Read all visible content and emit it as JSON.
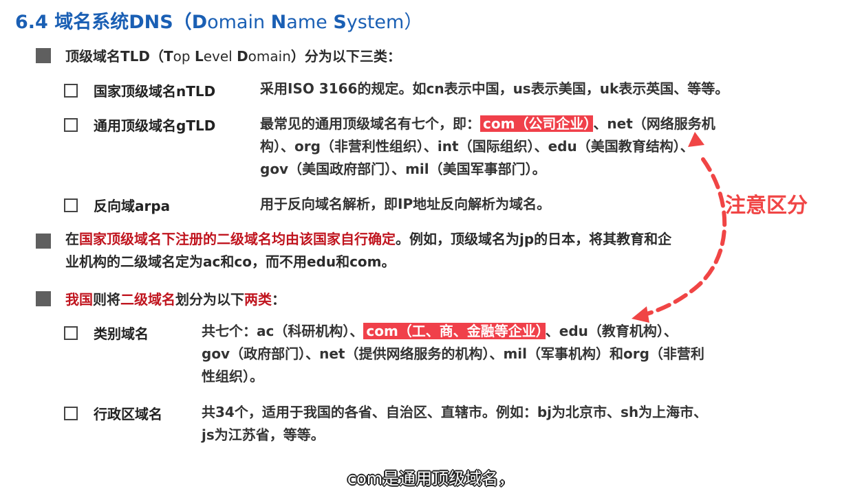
{
  "title": {
    "prefix": "6.4 域名系统DNS（",
    "d": "D",
    "omain": "omain ",
    "n": "N",
    "ame": "ame ",
    "s": "S",
    "ystem": "ystem）"
  },
  "tld_heading": {
    "prefix": "顶级域名TLD（",
    "t": "T",
    "op": "op ",
    "l": "L",
    "evel": "evel ",
    "d": "D",
    "omain": "omain",
    "suffix": "）分为以下三类："
  },
  "ntld": {
    "term": "国家顶级域名nTLD",
    "desc": "采用ISO 3166的规定。如cn表示中国，us表示美国，uk表示英国、等等。"
  },
  "gtld": {
    "term": "通用顶级域名gTLD",
    "line1_prefix": "最常见的通用顶级域名有七个，即：",
    "line1_highlight": "com（公司企业）",
    "line1_suffix": "、net（网络服务机",
    "line2": "构）、org（非营利性组织）、int（国际组织）、edu（美国教育结构）、",
    "line3": "gov（美国政府部门）、mil（美国军事部门）。"
  },
  "arpa": {
    "term": "反向域arpa",
    "desc": "用于反向域名解析，即IP地址反向解析为域名。"
  },
  "country_rule": {
    "pre": "在",
    "red1": "国家顶级域名下注册的二级域名均由该国家自行确定",
    "line1_rest": "。例如，顶级域名为jp的日本，将其教育和企",
    "line2": "业机构的二级域名定为ac和co，而不用edu和com。"
  },
  "china_heading": {
    "red1": "我国",
    "t1": "则将",
    "red2": "二级域名",
    "t2": "划分为以下",
    "red3": "两类",
    "t3": "："
  },
  "category": {
    "term": "类别域名",
    "line1_prefix": "共七个：ac（科研机构）、",
    "line1_highlight": "com（工、商、金融等企业）",
    "line1_suffix": "、edu（教育机构）、",
    "line2": "gov（政府部门）、net（提供网络服务的机构）、mil（军事机构）和org（非营利",
    "line3": "性组织）。"
  },
  "admin": {
    "term": "行政区域名",
    "line1": "共34个，适用于我国的各省、自治区、直辖市。例如：bj为北京市、sh为上海市、",
    "line2": "js为江苏省，等等。"
  },
  "annotation": "注意区分",
  "subtitle": "com是通用顶级域名，",
  "colors": {
    "title_blue": "#1a5fb4",
    "emphasis_red": "#c0151f",
    "highlight_bg": "#f0404a",
    "annotation_red": "#f04545"
  }
}
